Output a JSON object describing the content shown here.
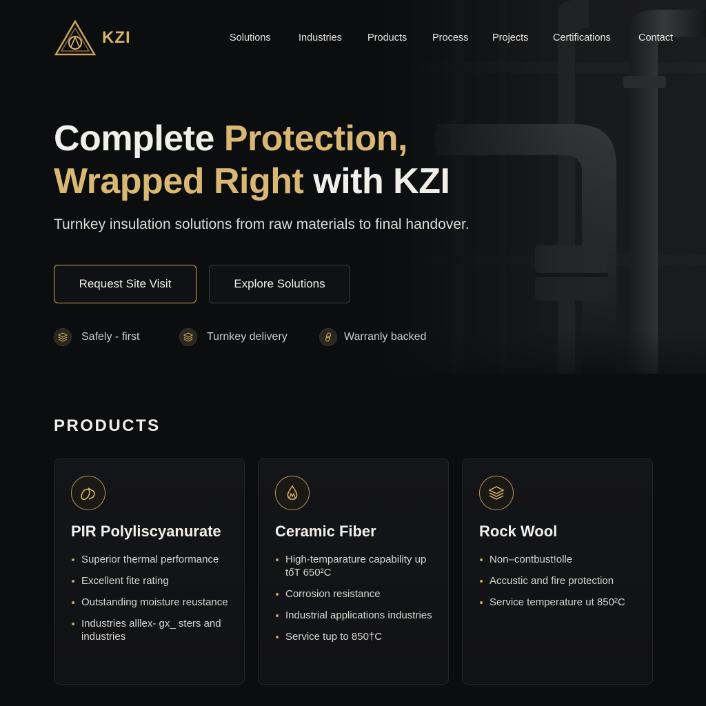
{
  "brand": {
    "name": "KZI",
    "logo_icon": "triangle-emblem-icon"
  },
  "nav": {
    "items": [
      "Solutions",
      "Industries",
      "Products",
      "Process",
      "Projects",
      "Certifications",
      "Contact"
    ]
  },
  "hero": {
    "headline": {
      "part1": "Complete ",
      "part2": "Protection,",
      "part3": "Wrapped Right",
      "part4": " with KZI"
    },
    "subtitle": "Turnkey insulation solutions from raw materials to final handover.",
    "primary_cta": "Request Site Visit",
    "secondary_cta": "Explore Solutions",
    "badges": [
      {
        "icon": "layers-icon",
        "label": "Safely - first"
      },
      {
        "icon": "layers-icon",
        "label": "Turnkey delivery"
      },
      {
        "icon": "link-icon",
        "label": "Warranly backed"
      }
    ]
  },
  "products": {
    "title": "PRODUCTS",
    "cards": [
      {
        "icon": "pipe-roll-icon",
        "title": "PIR Polyliscyanurate",
        "features": [
          "Superior thermal performance",
          "Excellent fite rating",
          "Outstanding moisture reustance",
          "Industries alllex- gx_ sters and industries"
        ]
      },
      {
        "icon": "flame-icon",
        "title": "Ceramic Fiber",
        "features": [
          "High-temparature capability up tőT 650²C",
          "Corrosion resistance",
          "Industrial applications industries",
          "Service tup to 850†C"
        ]
      },
      {
        "icon": "layers-icon",
        "title": "Rock Wool",
        "features": [
          "Non–contbust!olle",
          "Accustic and fire protection",
          "Service temperature ut 850²C"
        ]
      }
    ]
  },
  "colors": {
    "accent": "#d9b874",
    "background": "#0c0d0f",
    "card_border": "#25262a"
  }
}
